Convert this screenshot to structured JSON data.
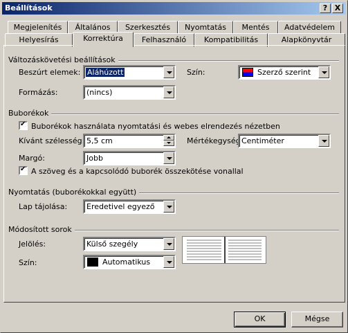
{
  "window": {
    "title": "Beállítások",
    "help_label": "?",
    "close_label": "X"
  },
  "tabs_row1": [
    "Megjelenítés",
    "Általános",
    "Szerkesztés",
    "Nyomtatás",
    "Mentés",
    "Adatvédelem"
  ],
  "tabs_row2": [
    "Helyesírás",
    "Korrektúra",
    "Felhasználó",
    "Kompatibilitás",
    "Alapkönyvtár"
  ],
  "active_tab": "Korrektúra",
  "tracking": {
    "group_title": "Változáskövetési beállítások",
    "inserted_label": "Beszúrt elemek:",
    "inserted_value": "Aláhúzott",
    "color_label": "Szín:",
    "color_value": "Szerző szerint",
    "format_label": "Formázás:",
    "format_value": "(nincs)"
  },
  "balloons": {
    "group_title": "Buborékok",
    "use_balloons_label": "Buborékok használata nyomtatási és webes elrendezés nézetben",
    "width_label": "Kívánt szélesség:",
    "width_value": "5,5 cm",
    "unit_label": "Mértékegység:",
    "unit_value": "Centiméter",
    "margin_label": "Margó:",
    "margin_value": "Jobb",
    "connect_label": "A szöveg és a kapcsolódó buborék összekötése vonallal"
  },
  "printing": {
    "group_title": "Nyomtatás (buborékokkal együtt)",
    "orientation_label": "Lap tájolása:",
    "orientation_value": "Eredetivel egyező"
  },
  "changed_lines": {
    "group_title": "Módosított sorok",
    "mark_label": "Jelölés:",
    "mark_value": "Külső szegély",
    "color_label": "Szín:",
    "color_value": "Automatikus"
  },
  "buttons": {
    "ok": "OK",
    "cancel": "Mégse"
  },
  "colors": {
    "titlebar_start": "#0a246a",
    "titlebar_end": "#a6caf0",
    "selection": "#0a246a",
    "face": "#d4d0c8"
  }
}
